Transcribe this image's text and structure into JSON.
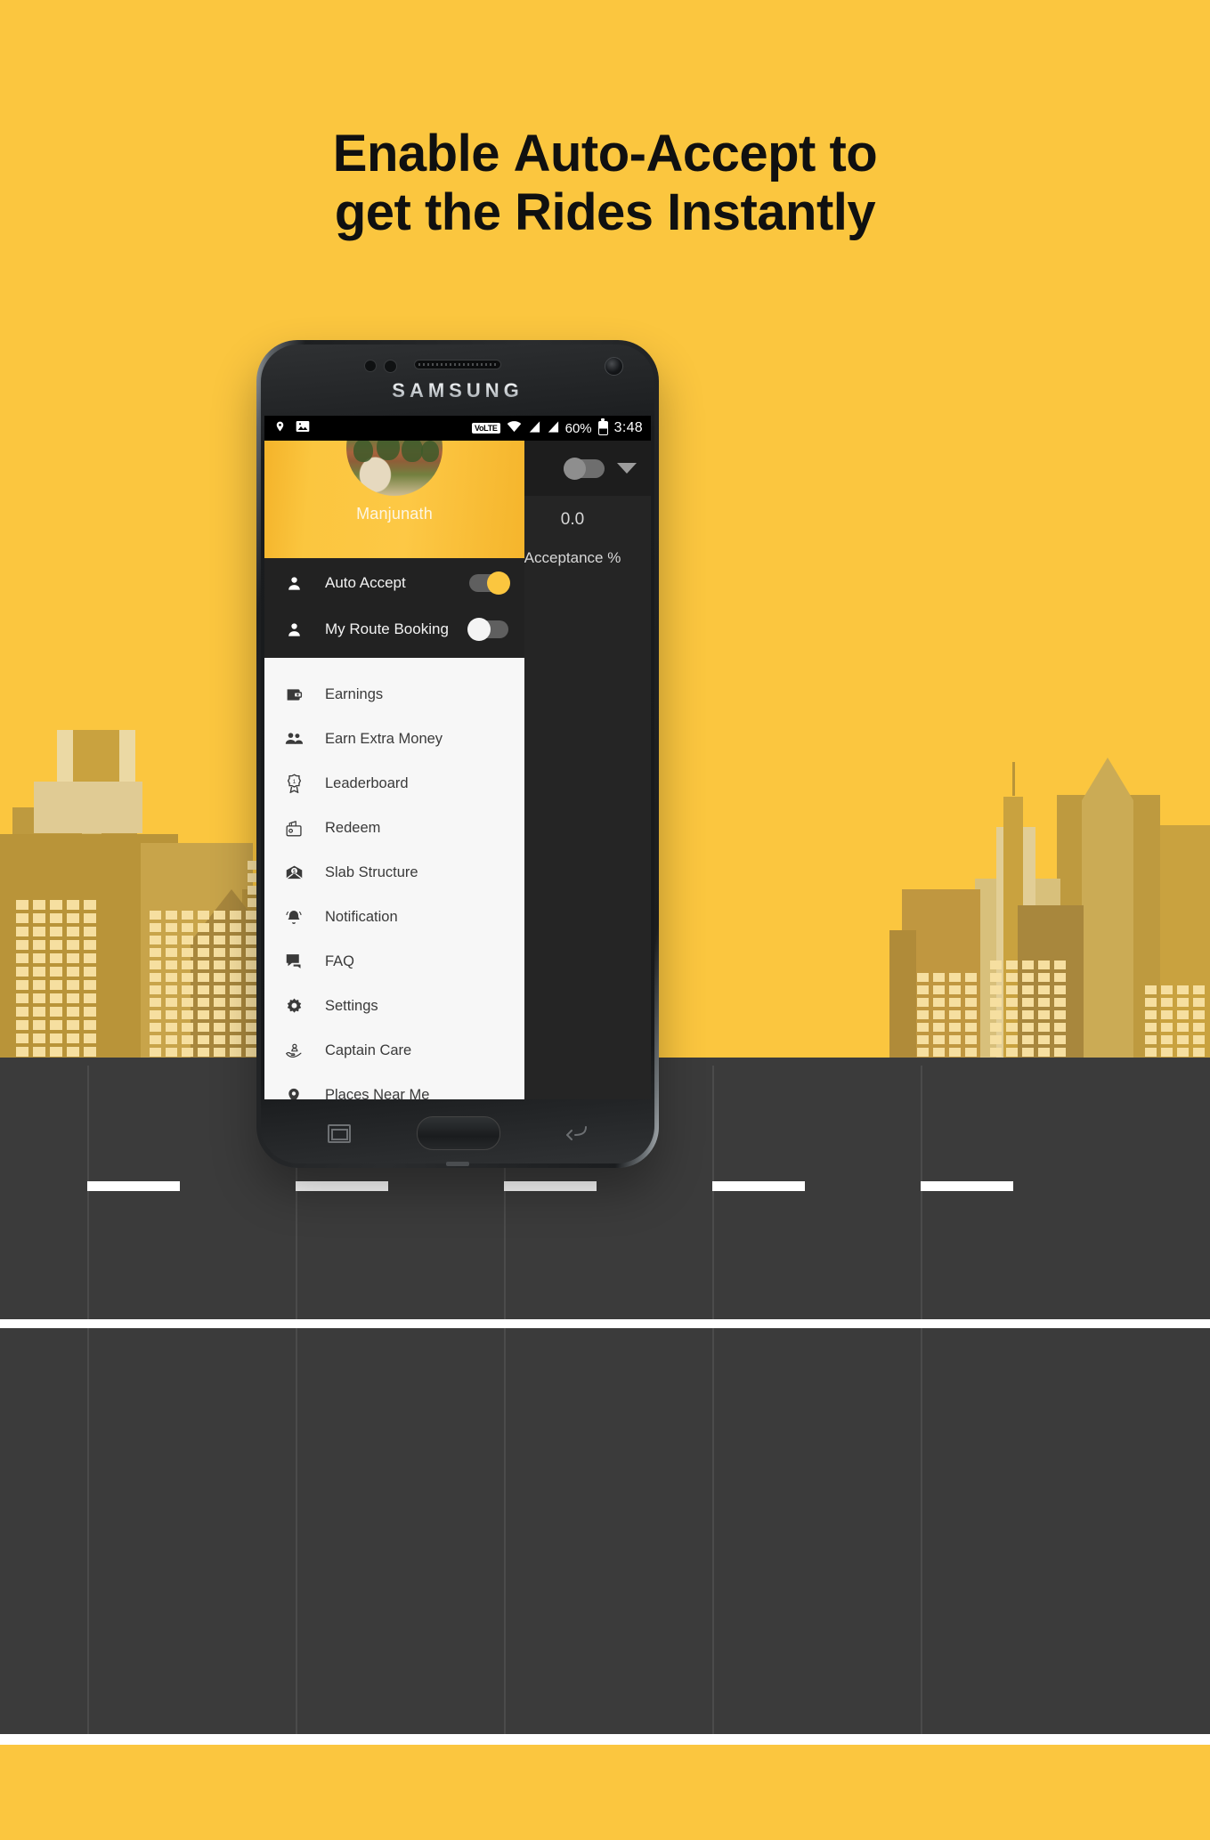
{
  "headline": {
    "line1_light": "Enable ",
    "line1_bold": "Auto-Accept",
    "line1_tail": " to",
    "line2_light": "get the ",
    "line2_bold": "Rides Instantly"
  },
  "colors": {
    "brand_yellow": "#FBC63F",
    "headline_black": "#101010",
    "drawer_dark": "#222222",
    "drawer_list_bg": "#f7f7f7",
    "road_grey": "#3B3B3B"
  },
  "phone": {
    "brand": "SAMSUNG"
  },
  "status_bar": {
    "location_icon": "location-pin-icon",
    "gallery_icon": "image-icon",
    "volte": "VoLTE",
    "wifi_icon": "wifi-icon",
    "signal1_icon": "signal-bars-icon",
    "signal2_icon": "signal-bars-icon",
    "battery_percent": "60%",
    "battery_icon": "battery-icon",
    "time": "3:48"
  },
  "app_behind": {
    "duty_toggle_state": "off",
    "dropdown_icon": "chevron-down-icon",
    "stat_value": "0.0",
    "stat_label": "Acceptance %"
  },
  "drawer": {
    "user_name": "Manjunath",
    "avatar_icon": "user-avatar-photo",
    "toggles": [
      {
        "label": "Auto Accept",
        "icon": "person-icon",
        "state": "on"
      },
      {
        "label": "My Route Booking",
        "icon": "person-icon",
        "state": "off"
      }
    ],
    "menu": [
      {
        "label": "Earnings",
        "icon": "wallet-icon"
      },
      {
        "label": "Earn Extra Money",
        "icon": "people-icon"
      },
      {
        "label": "Leaderboard",
        "icon": "award-badge-icon"
      },
      {
        "label": "Redeem",
        "icon": "cash-wallet-icon"
      },
      {
        "label": "Slab Structure",
        "icon": "envelope-dollar-icon"
      },
      {
        "label": "Notification",
        "icon": "bell-icon"
      },
      {
        "label": "FAQ",
        "icon": "chat-bubble-icon"
      },
      {
        "label": "Settings",
        "icon": "gear-icon"
      },
      {
        "label": "Captain Care",
        "icon": "hand-care-icon"
      },
      {
        "label": "Places Near Me",
        "icon": "location-pin-icon"
      }
    ]
  },
  "nav_bar": {
    "recents_icon": "recents-icon",
    "home_icon": "home-button",
    "back_icon": "back-icon"
  }
}
